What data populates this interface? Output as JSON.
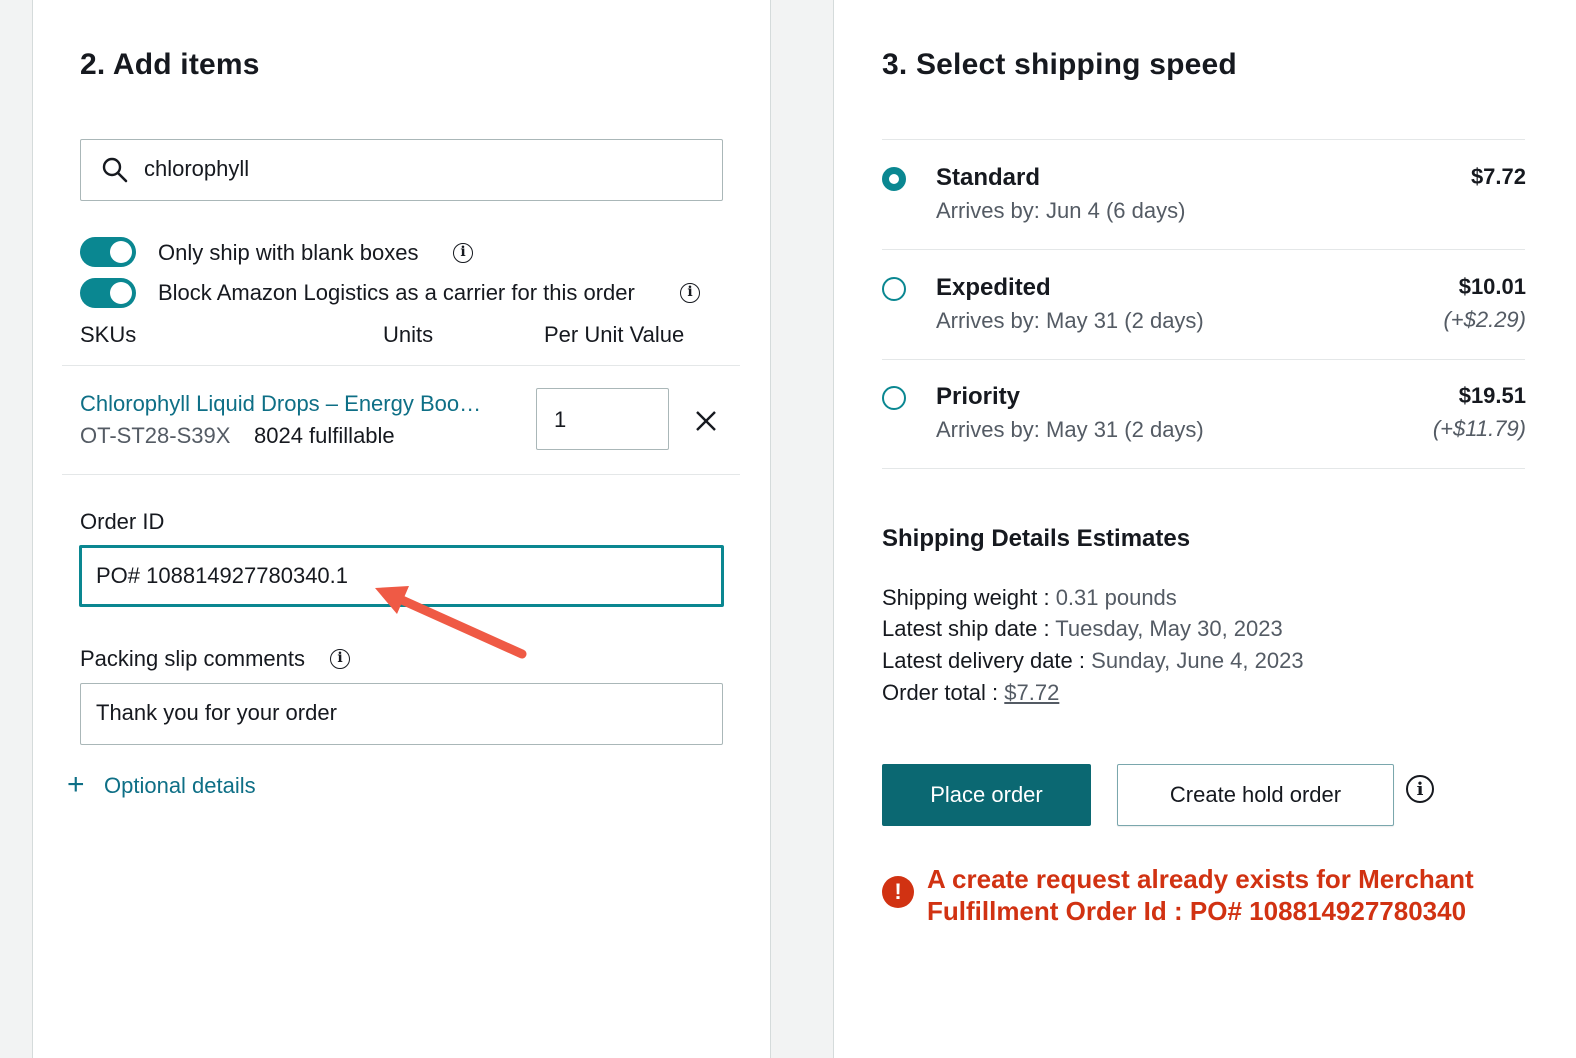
{
  "items_section": {
    "title": "2. Add items",
    "search": {
      "value": "chlorophyll",
      "icon": "search-icon"
    },
    "toggles": [
      {
        "label": "Only ship with blank boxes",
        "on": true
      },
      {
        "label": "Block Amazon Logistics as a carrier for this order",
        "on": true
      }
    ],
    "columns": {
      "skus": "SKUs",
      "units": "Units",
      "per_unit_value": "Per Unit Value"
    },
    "item": {
      "name": "Chlorophyll Liquid Drops – Energy Boo…",
      "sku": "OT-ST28-S39X",
      "fulfillable": "8024 fulfillable",
      "units": "1",
      "remove_icon": "close-icon"
    },
    "order_id": {
      "label": "Order ID",
      "value": "PO# 108814927780340.1"
    },
    "packing_slip": {
      "label": "Packing slip comments",
      "value": "Thank you for your order"
    },
    "optional_details": {
      "icon": "+",
      "label": "Optional details"
    }
  },
  "shipping_section": {
    "title": "3. Select shipping speed",
    "options": [
      {
        "name": "Standard",
        "arrives": "Arrives by: Jun 4 (6 days)",
        "price": "$7.72",
        "diff": "",
        "selected": true
      },
      {
        "name": "Expedited",
        "arrives": "Arrives by: May 31 (2 days)",
        "price": "$10.01",
        "diff": "(+$2.29)",
        "selected": false
      },
      {
        "name": "Priority",
        "arrives": "Arrives by: May 31 (2 days)",
        "price": "$19.51",
        "diff": "(+$11.79)",
        "selected": false
      }
    ],
    "details": {
      "title": "Shipping Details Estimates",
      "weight_label": "Shipping weight :",
      "weight_value": "0.31 pounds",
      "ship_date_label": "Latest ship date :",
      "ship_date_value": "Tuesday, May 30, 2023",
      "delivery_date_label": "Latest delivery date :",
      "delivery_date_value": "Sunday, June 4, 2023",
      "total_label": "Order total :",
      "total_value": "$7.72"
    },
    "buttons": {
      "place_order": "Place order",
      "create_hold": "Create hold order"
    },
    "error": {
      "line1": "A create request already exists for Merchant",
      "line2": "Fulfillment Order Id : PO# 108814927780340"
    }
  },
  "colors": {
    "accent": "#0a8791",
    "primary_button": "#0b6872",
    "error": "#d13212",
    "link": "#0e6f86",
    "annotation_arrow": "#ef5a45"
  }
}
